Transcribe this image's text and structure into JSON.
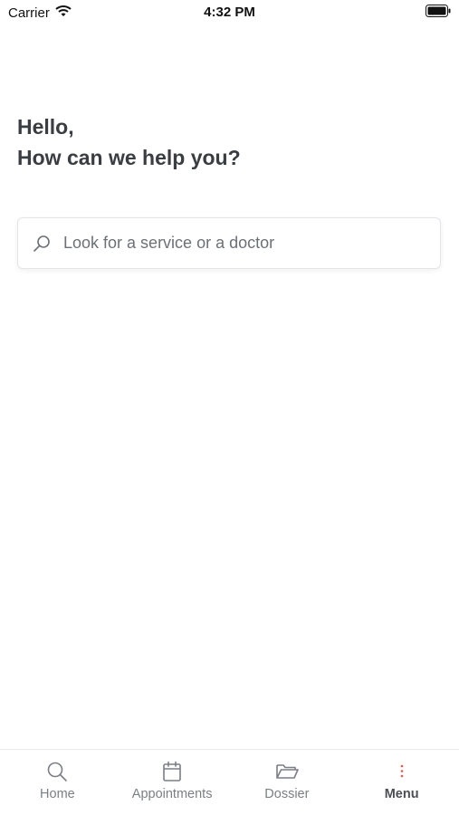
{
  "status_bar": {
    "carrier": "Carrier",
    "time": "4:32 PM"
  },
  "greeting": {
    "line1": "Hello,",
    "line2": "How can we help you?"
  },
  "search": {
    "placeholder": "Look for a service or a doctor",
    "value": ""
  },
  "tabs": [
    {
      "label": "Home",
      "icon": "search-icon"
    },
    {
      "label": "Appointments",
      "icon": "calendar-icon"
    },
    {
      "label": "Dossier",
      "icon": "folder-icon"
    },
    {
      "label": "Menu",
      "icon": "more-vertical-icon",
      "active": true
    }
  ],
  "colors": {
    "menu_dots": "#e05a4f",
    "text": "#3a3d42",
    "tab_inactive": "#7a7f86"
  }
}
